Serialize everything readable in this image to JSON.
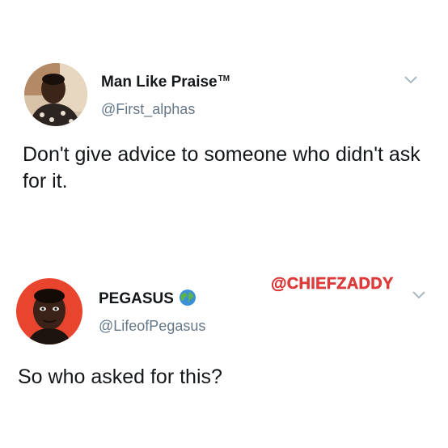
{
  "tweets": [
    {
      "display_name": "Man Like Praise",
      "name_badge": "TM",
      "handle": "@First_alphas",
      "text": "Don't give advice to someone who didn't ask for it.",
      "avatar_icon": "person-avatar-icon",
      "menu_icon": "chevron-down-icon"
    },
    {
      "display_name": "PEGASUS",
      "name_badge_icon": "globe-emoji-icon",
      "handle": "@LifeofPegasus",
      "text": "So who asked for this?",
      "avatar_icon": "person-avatar-icon",
      "menu_icon": "chevron-down-icon"
    }
  ],
  "watermark": {
    "text": "@CHIEFZADDY",
    "color": "#e23b3b"
  },
  "colors": {
    "name": "#14171a",
    "handle": "#657786",
    "chevron": "#aab8c2",
    "avatar2_bg": "#e8442e"
  }
}
